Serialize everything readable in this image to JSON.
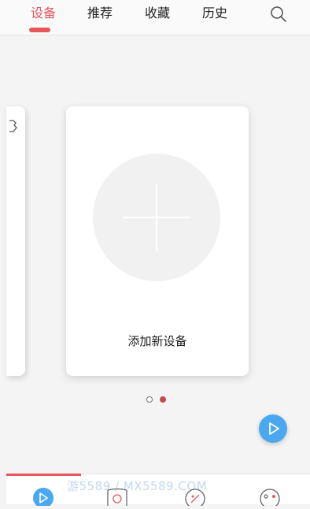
{
  "tabs": [
    {
      "label": "设备",
      "active": true
    },
    {
      "label": "推荐",
      "active": false
    },
    {
      "label": "收藏",
      "active": false
    },
    {
      "label": "历史",
      "active": false
    }
  ],
  "search_icon": "search-icon",
  "carousel": {
    "card": {
      "label": "添加新设备",
      "icon": "plus-icon"
    },
    "pages": 2,
    "current_page": 2
  },
  "fab_icon": "play-icon",
  "bottom_nav": {
    "active_index": 0,
    "items": [
      {
        "icon": "play-icon"
      },
      {
        "icon": "camera-icon"
      },
      {
        "icon": "compass-icon"
      },
      {
        "icon": "face-icon"
      }
    ]
  },
  "watermark": "游5589 / MX5589.COM",
  "colors": {
    "accent": "#e8555b",
    "fab": "#4aa8f0",
    "background": "#f4f4f4"
  }
}
